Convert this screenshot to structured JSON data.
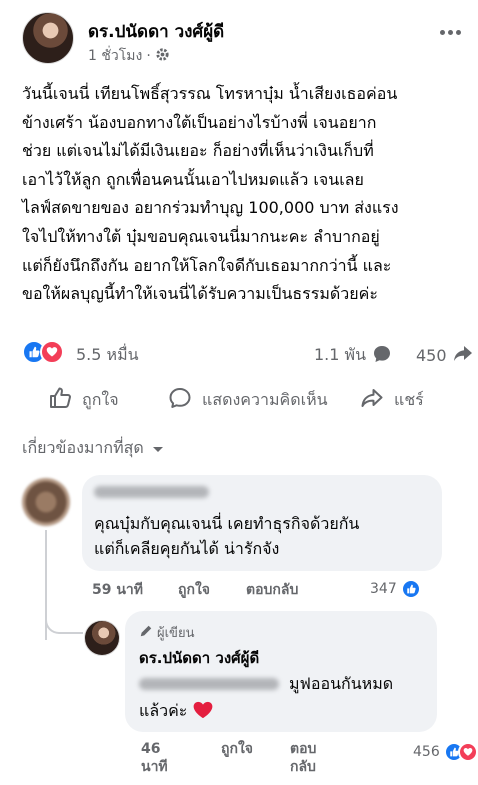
{
  "post": {
    "author": "ดร.ปนัดดา วงศ์ผู้ดี",
    "time": "1 ชั่วโมง",
    "privacy_icon": "gear-icon",
    "lines": [
      "วันนี้เจนนี่ เทียนโพธิ์สุวรรณ โทรหาบุ๋ม น้ำเสียงเธอค่อน",
      "ข้างเศร้า น้องบอกทางใต้เป็นอย่างไรบ้างพี่ เจนอยาก",
      "ช่วย แต่เจนไม่ได้มีเงินเยอะ ก็อย่างที่เห็นว่าเงินเก็บที่",
      "เอาไว้ให้ลูก ถูกเพื่อนคนนั้นเอาไปหมดแล้ว เจนเลย",
      "ไลฟ์สดขายของ อยากร่วมทำบุญ 100,000 บาท ส่งแรง",
      "ใจไปให้ทางใต้ บุ๋มขอบคุณเจนนี่มากนะคะ ลำบากอยู่",
      "แต่ก็ยังนึกถึงกัน อยากให้โลกใจดีกับเธอมากกว่านี้ และ",
      "ขอให้ผลบุญนี้ทำให้เจนนี่ได้รับความเป็นธรรมด้วยค่ะ"
    ]
  },
  "stats": {
    "reactions": "5.5 หมื่น",
    "comments": "1.1 พัน",
    "shares": "450"
  },
  "actions": {
    "like": "ถูกใจ",
    "comment": "แสดงความคิดเห็น",
    "share": "แชร์"
  },
  "comments": {
    "sort_label": "เกี่ยวข้องมากที่สุด",
    "first": {
      "line1": "คุณบุ๋มกับคุณเจนนี่ เคยทำธุรกิจด้วยกัน",
      "line2": "แต่ก็เคลียคุยกันได้ น่ารักจัง",
      "time": "59 นาที",
      "like": "ถูกใจ",
      "reply": "ตอบกลับ",
      "count": "347"
    },
    "reply": {
      "badge": "ผู้เขียน",
      "author": "ดร.ปนัดดา วงศ์ผู้ดี",
      "text1": "มูฟออนกันหมด",
      "text2": "แล้วค่ะ",
      "time_line1": "46",
      "time_line2": "นาที",
      "like": "ถูกใจ",
      "reply_line1": "ตอบ",
      "reply_line2": "กลับ",
      "count": "456"
    }
  },
  "colors": {
    "like_blue": "#1877f2",
    "love_red": "#f33e58",
    "secondary_text": "#65676b",
    "bubble_bg": "#f0f2f5"
  }
}
